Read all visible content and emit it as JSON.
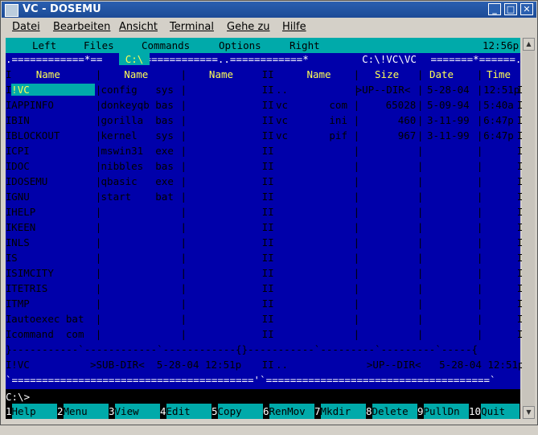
{
  "window": {
    "title": "VC - DOSEMU"
  },
  "menubar": {
    "items": [
      "Datei",
      "Bearbeiten",
      "Ansicht",
      "Terminal",
      "Gehe zu",
      "Hilfe"
    ]
  },
  "vc_menu": {
    "left": "Left",
    "files": "Files",
    "commands": "Commands",
    "options": "Options",
    "right": "Right",
    "clock": "12:56p"
  },
  "left_panel": {
    "drive": " C:\\ ",
    "headers": [
      "Name",
      "Name",
      "Name"
    ],
    "col1": [
      "!VC",
      "APPINFO",
      "BIN",
      "BLOCKOUT",
      "CPI",
      "DOC",
      "DOSEMU",
      "GNU",
      "HELP",
      "KEEN",
      "NLS",
      "S",
      "SIMCITY",
      "TETRIS",
      "TMP",
      "autoexec bat",
      "command  com"
    ],
    "col2": [
      "config   sys",
      "donkeyqb bas",
      "gorilla  bas",
      "kernel   sys",
      "mswin31  exe",
      "nibbles  bas",
      "qbasic   exe",
      "start    bat"
    ],
    "status": "!VC          >SUB-DIR<  5-28-04 12:51p"
  },
  "right_panel": {
    "path": " C:\\!VC\\VC ",
    "headers": [
      "Name",
      "Size",
      "Date",
      "Time"
    ],
    "files": [
      {
        "name": "..",
        "ext": "",
        "size": ">UP--DIR<",
        "date": "5-28-04",
        "time": "12:51p"
      },
      {
        "name": "vc",
        "ext": "com",
        "size": "65028",
        "date": "5-09-94",
        "time": "5:40a"
      },
      {
        "name": "vc",
        "ext": "ini",
        "size": "460",
        "date": "3-11-99",
        "time": "6:47p"
      },
      {
        "name": "vc",
        "ext": "pif",
        "size": "967",
        "date": "3-11-99",
        "time": "6:47p"
      }
    ],
    "status": "..             >UP--DIR<   5-28-04 12:51p"
  },
  "prompt": "C:\\>",
  "function_keys": [
    {
      "num": "1",
      "label": "Help"
    },
    {
      "num": "2",
      "label": "Menu"
    },
    {
      "num": "3",
      "label": "View"
    },
    {
      "num": "4",
      "label": "Edit"
    },
    {
      "num": "5",
      "label": "Copy"
    },
    {
      "num": "6",
      "label": "RenMov"
    },
    {
      "num": "7",
      "label": "Mkdir"
    },
    {
      "num": "8",
      "label": "Delete"
    },
    {
      "num": "9",
      "label": "PullDn"
    },
    {
      "num": "10",
      "label": "Quit"
    }
  ],
  "colors": {
    "panel_bg": "#0000aa",
    "panel_fg": "#55ffff",
    "highlight": "#00aaaa",
    "title_bg": "#1c4a96"
  }
}
